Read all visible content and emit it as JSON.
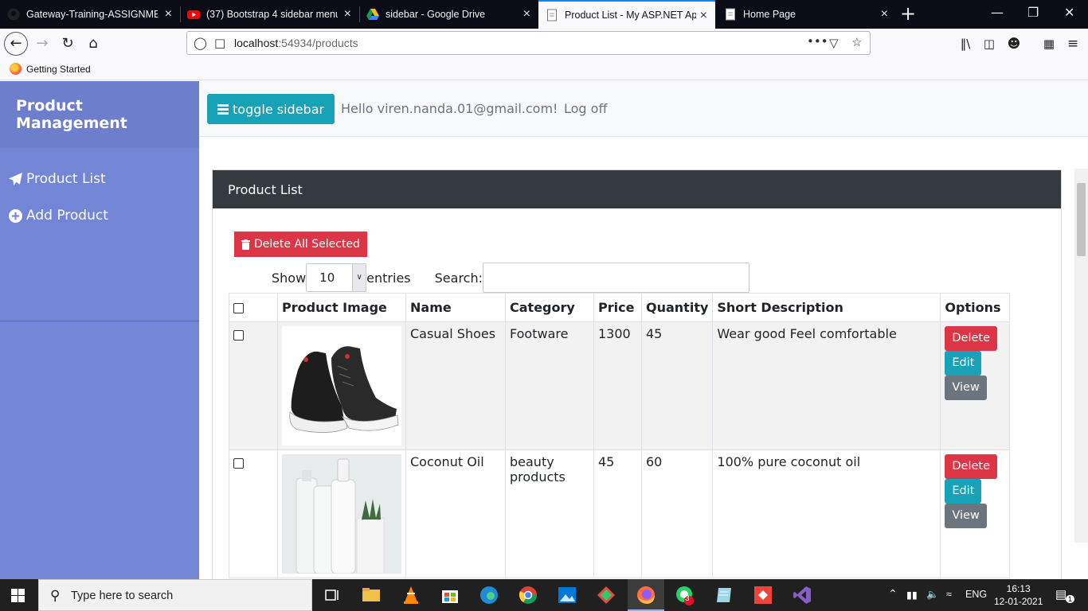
{
  "browser": {
    "tabs": [
      {
        "title": "Gateway-Training-ASSIGNMEN",
        "active": false
      },
      {
        "title": "(37) Bootstrap 4 sidebar menu w",
        "active": false
      },
      {
        "title": "sidebar - Google Drive",
        "active": false
      },
      {
        "title": "Product List - My ASP.NET App",
        "active": true
      },
      {
        "title": "Home Page",
        "active": false
      }
    ],
    "url_host": "localhost",
    "url_rest": ":54934/products",
    "bookmark": "Getting Started",
    "new_tab_glyph": "+",
    "close_glyph": "×"
  },
  "sidebar": {
    "title": "Product Management",
    "items": [
      {
        "label": "Product List",
        "icon": "paper-plane-icon"
      },
      {
        "label": "Add Product",
        "icon": "plus-circle-icon"
      }
    ]
  },
  "topnav": {
    "toggle_label": "toggle sidebar",
    "greeting": "Hello viren.nanda.01@gmail.com!",
    "logoff": "Log off"
  },
  "card": {
    "title": "Product List",
    "delete_all_label": "Delete All Selected",
    "show_label": "Show",
    "entries_value": "10",
    "entries_label": "entries",
    "search_label": "Search:",
    "search_value": ""
  },
  "table": {
    "headers": [
      "Product Image",
      "Name",
      "Category",
      "Price",
      "Quantity",
      "Short Description",
      "Options"
    ],
    "rows": [
      {
        "name": "Casual Shoes",
        "category": "Footware",
        "price": "1300",
        "quantity": "45",
        "description": "Wear good Feel comfortable",
        "image": "shoe-image"
      },
      {
        "name": "Coconut Oil",
        "category": "beauty products",
        "price": "45",
        "quantity": "60",
        "description": "100% pure coconut oil",
        "image": "coconut-oil-image"
      }
    ],
    "actions": {
      "delete": "Delete",
      "edit": "Edit",
      "view": "View"
    }
  },
  "taskbar": {
    "search_placeholder": "Type here to search",
    "language": "ENG",
    "time": "16:13",
    "date": "12-01-2021",
    "notification_count": "1",
    "whatsapp_badge": "3"
  },
  "colors": {
    "sidebar": "#7386d5",
    "sidebar_header": "#6d7fcc",
    "toggle": "#17a2b8",
    "danger": "#dc3545",
    "info": "#17a2b8",
    "secondary": "#6c757d",
    "card_header": "#343a40"
  }
}
